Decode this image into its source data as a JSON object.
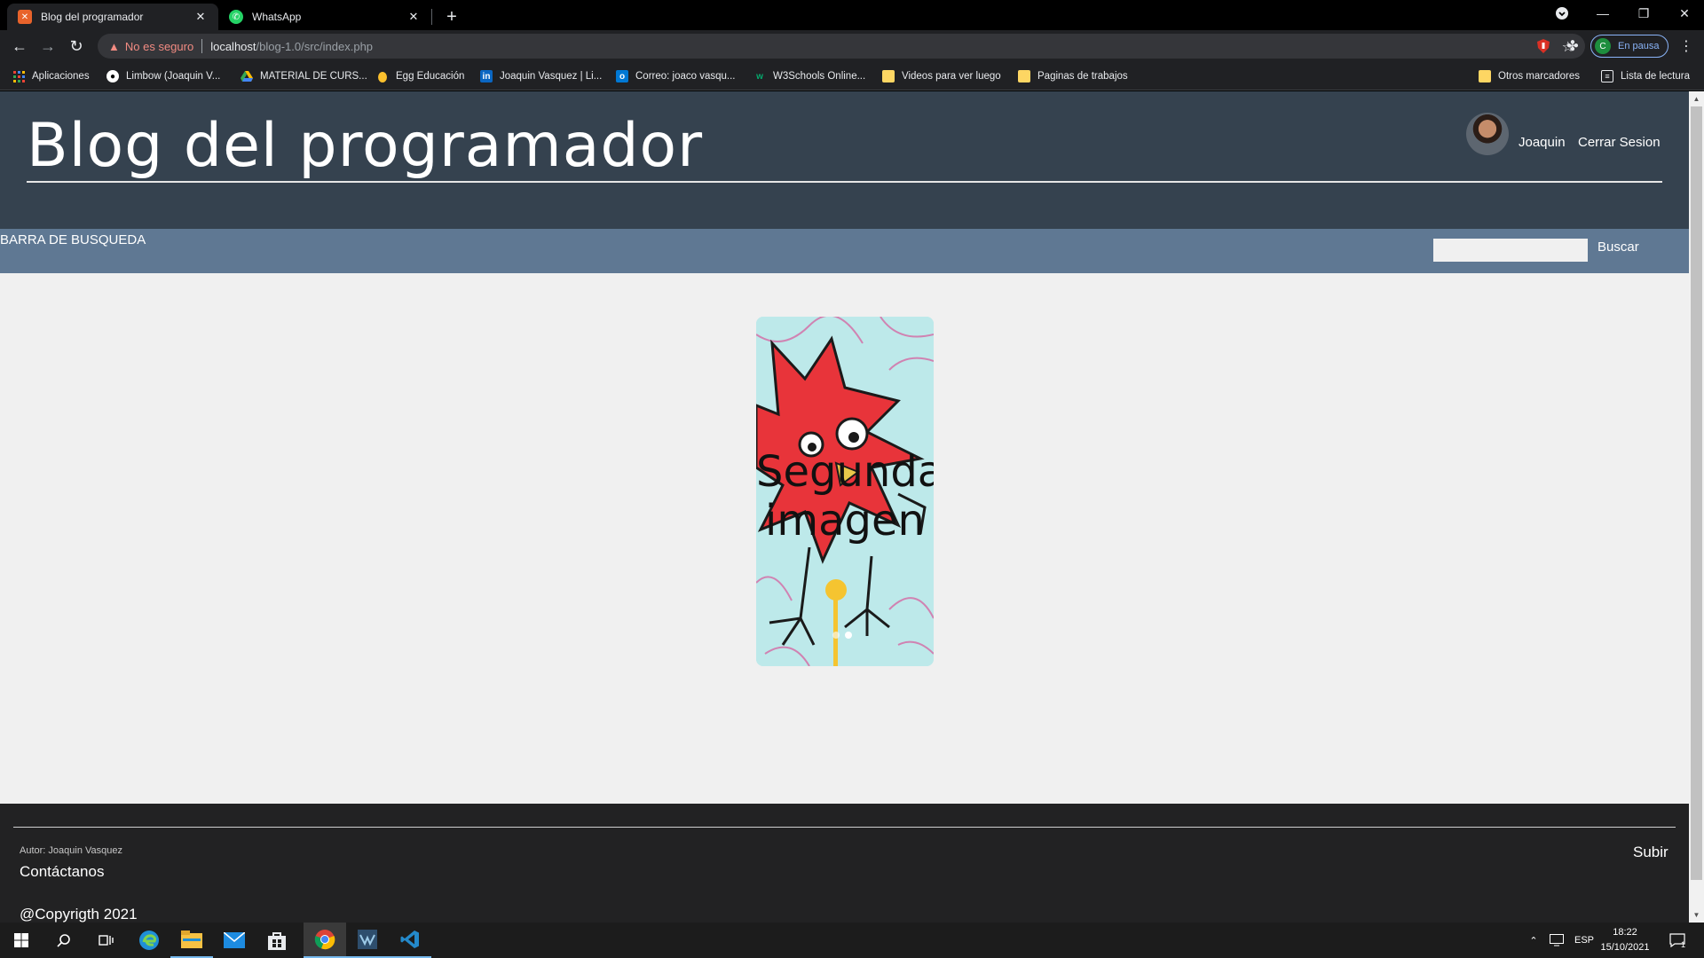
{
  "browser": {
    "tabs": [
      {
        "title": "Blog del programador",
        "active": true
      },
      {
        "title": "WhatsApp",
        "active": false
      }
    ],
    "address": {
      "security_label": "No es seguro",
      "host": "localhost",
      "path": "/blog-1.0/src/index.php"
    },
    "profile": {
      "initial": "C",
      "status": "En pausa"
    },
    "bookmarks": [
      {
        "label": "Aplicaciones",
        "icon": "apps-grid-icon"
      },
      {
        "label": "Limbow (Joaquin V...",
        "icon": "github-icon"
      },
      {
        "label": "MATERIAL DE CURS...",
        "icon": "google-drive-icon"
      },
      {
        "label": "Egg Educación",
        "icon": "egg-icon"
      },
      {
        "label": "Joaquin Vasquez | Li...",
        "icon": "linkedin-icon"
      },
      {
        "label": "Correo: joaco vasqu...",
        "icon": "outlook-icon"
      },
      {
        "label": "W3Schools Online...",
        "icon": "w3schools-icon"
      },
      {
        "label": "Videos para ver luego",
        "icon": "folder-icon"
      },
      {
        "label": "Paginas de trabajos",
        "icon": "folder-icon"
      }
    ],
    "other_bookmarks": "Otros marcadores",
    "reading_list": "Lista de lectura"
  },
  "site": {
    "title": "Blog del programador",
    "user_name": "Joaquin",
    "logout": "Cerrar Sesion",
    "search": {
      "title": "BARRA DE BUSQUEDA",
      "value": "",
      "button": "Buscar"
    },
    "slider": {
      "caption": "Segunda imagen",
      "slide_count": 2,
      "active_slide": 1
    },
    "footer": {
      "author": "Autor: Joaquin Vasquez",
      "contact": "Contáctanos",
      "copyright": "@Copyrigth 2021",
      "up": "Subir"
    }
  },
  "taskbar": {
    "apps": [
      "windows-start-icon",
      "search-icon",
      "task-view-icon",
      "edge-icon",
      "file-explorer-icon",
      "mail-icon",
      "store-icon",
      "chrome-icon",
      "mysql-workbench-icon",
      "vscode-icon"
    ],
    "language": "ESP",
    "time": "18:22",
    "date": "15/10/2021",
    "notifications": "1"
  },
  "colors": {
    "header_bg": "#35424f",
    "searchbar_bg": "#5f7893",
    "page_bg": "#f0f0f0",
    "footer_bg": "#222223"
  }
}
